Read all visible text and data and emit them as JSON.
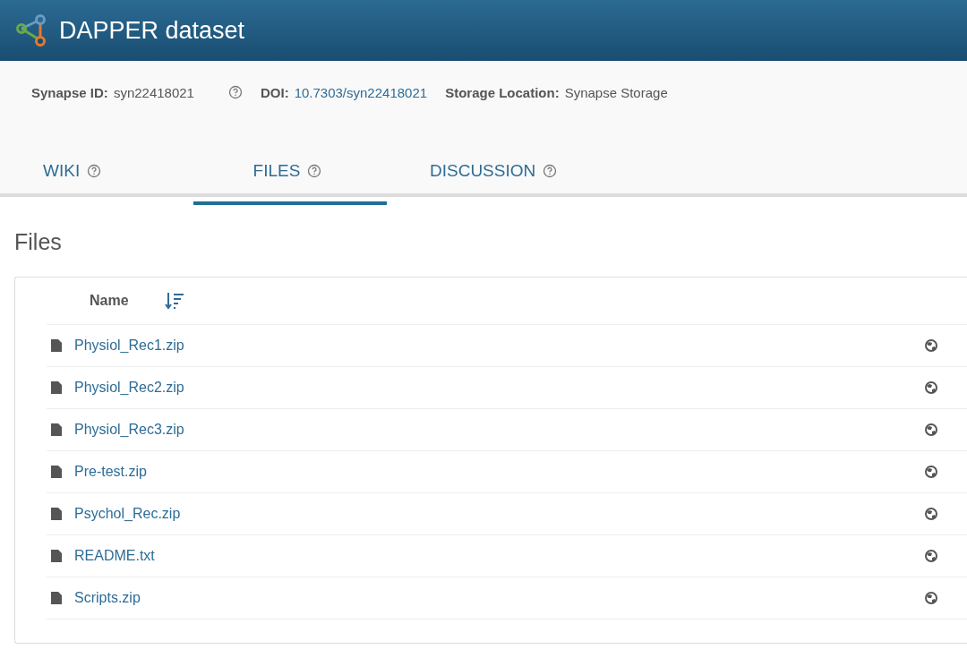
{
  "header": {
    "title": "DAPPER dataset"
  },
  "meta": [
    {
      "label": "Synapse ID:",
      "value": "syn22418021",
      "help": true,
      "kind": "plain"
    },
    {
      "label": "DOI:",
      "value": "10.7303/syn22418021",
      "help": false,
      "kind": "link"
    },
    {
      "label": "Storage Location:",
      "value": "Synapse Storage",
      "help": false,
      "kind": "plain"
    }
  ],
  "tabs": [
    {
      "label": "WIKI",
      "selected": false
    },
    {
      "label": "FILES",
      "selected": true
    },
    {
      "label": "DISCUSSION",
      "selected": false
    }
  ],
  "section_title": "Files",
  "table": {
    "columns": [
      "Name"
    ],
    "rows": [
      {
        "name": "Physiol_Rec1.zip"
      },
      {
        "name": "Physiol_Rec2.zip"
      },
      {
        "name": "Physiol_Rec3.zip"
      },
      {
        "name": "Pre-test.zip"
      },
      {
        "name": "Psychol_Rec.zip"
      },
      {
        "name": "README.txt"
      },
      {
        "name": "Scripts.zip"
      }
    ]
  }
}
